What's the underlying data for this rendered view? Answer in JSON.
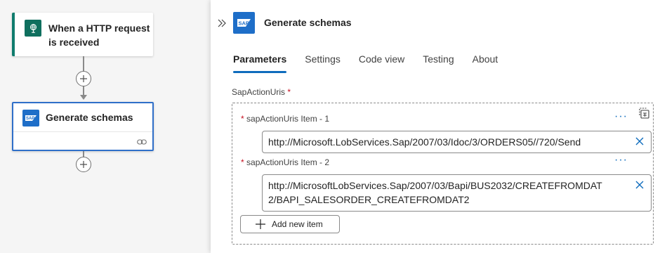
{
  "canvas": {
    "trigger": {
      "title": "When a HTTP request is received",
      "icon": "http-request-icon"
    },
    "action": {
      "title": "Generate schemas",
      "icon": "sap-icon"
    }
  },
  "panel": {
    "title": "Generate schemas",
    "tabs": [
      {
        "label": "Parameters",
        "active": true
      },
      {
        "label": "Settings"
      },
      {
        "label": "Code view"
      },
      {
        "label": "Testing"
      },
      {
        "label": "About"
      }
    ],
    "field": {
      "label": "SapActionUris",
      "required_mark": "*",
      "items": [
        {
          "label": "sapActionUris Item - 1",
          "value": "http://Microsoft.LobServices.Sap/2007/03/Idoc/3/ORDERS05//720/Send"
        },
        {
          "label": "sapActionUris Item - 2",
          "value": "http://MicrosoftLobServices.Sap/2007/03/Bapi/BUS2032/CREATEFROMDAT2/BAPI_SALESORDER_CREATEFROMDAT2"
        }
      ],
      "add_item_label": "Add new item"
    }
  },
  "colors": {
    "accent": "#0f6cbd",
    "trigger_accent": "#107c6d",
    "sap_blue": "#1e6ec8",
    "required": "#c50f1f"
  }
}
